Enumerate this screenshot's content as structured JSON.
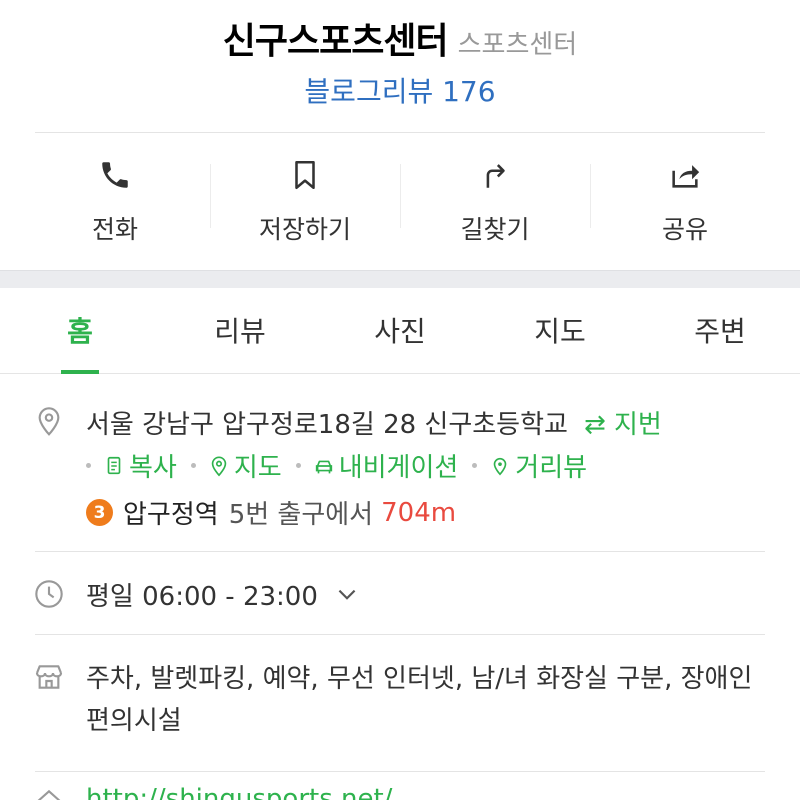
{
  "place": {
    "name": "신구스포츠센터",
    "category": "스포츠센터",
    "review_link": "블로그리뷰 176"
  },
  "actions": [
    {
      "label": "전화",
      "icon": "phone-icon"
    },
    {
      "label": "저장하기",
      "icon": "bookmark-icon"
    },
    {
      "label": "길찾기",
      "icon": "directions-icon"
    },
    {
      "label": "공유",
      "icon": "share-icon"
    }
  ],
  "tabs": [
    {
      "label": "홈",
      "active": true
    },
    {
      "label": "리뷰"
    },
    {
      "label": "사진"
    },
    {
      "label": "지도"
    },
    {
      "label": "주변"
    }
  ],
  "address": {
    "text": "서울 강남구 압구정로18길 28 신구초등학교",
    "jibun_label": "⇄ 지번",
    "links": [
      "복사",
      "지도",
      "내비게이션",
      "거리뷰"
    ]
  },
  "subway": {
    "line": "3",
    "line_color": "#ef7c1c",
    "station": "압구정역",
    "exit_text": "5번 출구에서",
    "distance": "704m"
  },
  "hours": {
    "text": "평일 06:00 - 23:00"
  },
  "facilities": {
    "text": "주차, 발렛파킹, 예약, 무선 인터넷, 남/녀 화장실 구분, 장애인 편의시설"
  },
  "homepage": {
    "text": "http://shingusports.net/"
  },
  "colors": {
    "accent": "#2eb24d",
    "link_blue": "#2f6fc0",
    "distance_red": "#e94a3f"
  }
}
